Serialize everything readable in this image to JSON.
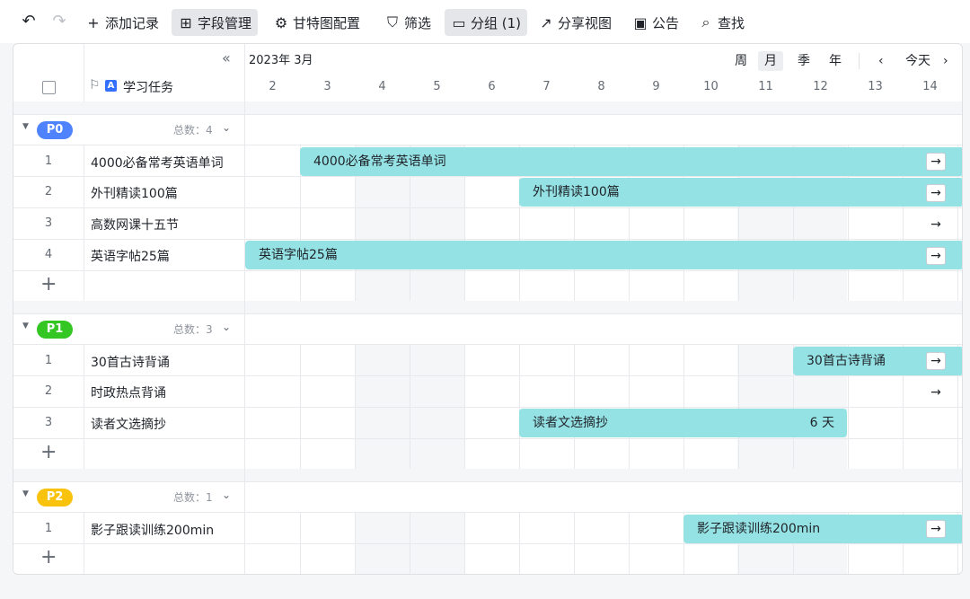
{
  "toolbar": {
    "undo_icon": "undo-icon",
    "redo_icon": "redo-icon",
    "add_record": "添加记录",
    "field_manage": "字段管理",
    "gantt_config": "甘特图配置",
    "filter": "筛选",
    "group": "分组 (1)",
    "share_view": "分享视图",
    "notice": "公告",
    "search": "查找"
  },
  "header": {
    "month_label": "2023年 3月",
    "column_title": "学习任务",
    "scale_week": "周",
    "scale_month": "月",
    "scale_quarter": "季",
    "scale_year": "年",
    "today": "今天",
    "days": [
      "2",
      "3",
      "4",
      "5",
      "6",
      "7",
      "8",
      "9",
      "10",
      "11",
      "12",
      "13",
      "14"
    ]
  },
  "groups": [
    {
      "name": "P0",
      "color": "#4e83fd",
      "count_label": "总数：4",
      "rows": [
        {
          "num": "1",
          "name": "4000必备常考英语单词"
        },
        {
          "num": "2",
          "name": "外刊精读100篇"
        },
        {
          "num": "3",
          "name": "高数网课十五节"
        },
        {
          "num": "4",
          "name": "英语字帖25篇"
        }
      ]
    },
    {
      "name": "P1",
      "color": "#34c724",
      "count_label": "总数：3",
      "rows": [
        {
          "num": "1",
          "name": "30首古诗背诵"
        },
        {
          "num": "2",
          "name": "时政热点背诵"
        },
        {
          "num": "3",
          "name": "读者文选摘抄"
        }
      ]
    },
    {
      "name": "P2",
      "color": "#f8c20d",
      "count_label": "总数：1",
      "rows": [
        {
          "num": "1",
          "name": "影子跟读训练200min"
        }
      ]
    }
  ],
  "bars": {
    "b1": "4000必备常考英语单词",
    "b2": "外刊精读100篇",
    "b3": "英语字帖25篇",
    "b4": "30首古诗背诵",
    "b5": "读者文选摘抄",
    "b5_duration": "6 天",
    "b6": "影子跟读训练200min"
  },
  "colors": {
    "bar": "#94e2e4",
    "weekend": "#f5f6f7"
  }
}
